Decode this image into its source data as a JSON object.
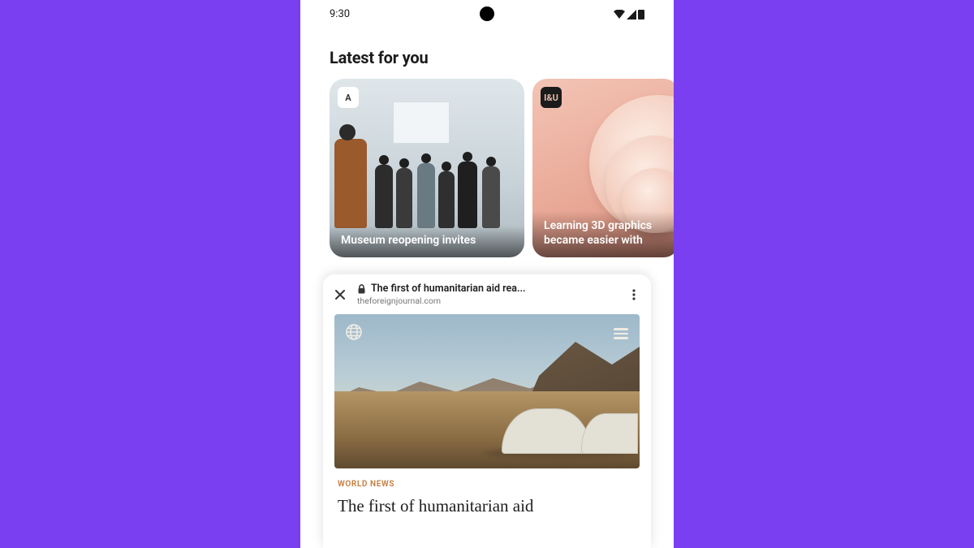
{
  "status_bar": {
    "time": "9:30"
  },
  "section": {
    "title": "Latest for you"
  },
  "cards": [
    {
      "badge": "A",
      "caption": "Museum reopening invites"
    },
    {
      "badge": "I&U",
      "caption": "Learning 3D graphics became easier with"
    }
  ],
  "custom_tab": {
    "title": "The first of humanitarian aid rea...",
    "domain": "theforeignjournal.com"
  },
  "article": {
    "category": "WORLD NEWS",
    "headline": "The first of humanitarian aid"
  }
}
